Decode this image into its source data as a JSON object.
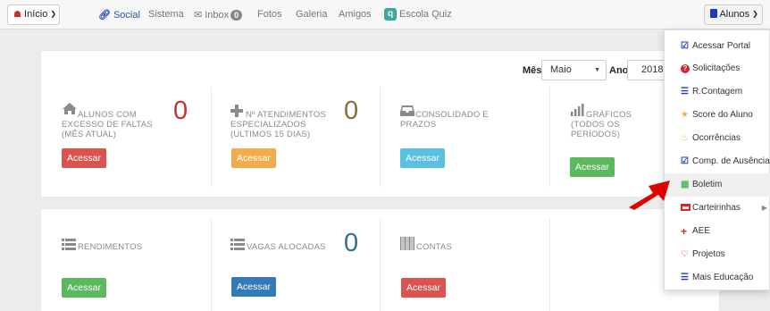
{
  "topbar": {
    "inicio_label": "Início",
    "nav": [
      {
        "label": "Social",
        "icon": "link-icon"
      },
      {
        "label": "Sistema",
        "icon": ""
      },
      {
        "label": "Inbox",
        "icon": "envelope-icon",
        "badge": "0"
      },
      {
        "label": "Fotos",
        "icon": ""
      },
      {
        "label": "Galeria",
        "icon": ""
      },
      {
        "label": "Amigos",
        "icon": ""
      },
      {
        "label": "Escola Quiz",
        "icon": "quiz-logo-icon"
      }
    ],
    "alunos_label": "Alunos"
  },
  "filters": {
    "mes_label": "Mês",
    "mes_value": "Maio",
    "ano_label": "Ano",
    "ano_value": "2018"
  },
  "cards_row1": [
    {
      "icon": "home-icon",
      "title_lines": [
        "ALUNOS COM",
        "EXCESSO DE FALTAS",
        "(MÊS ATUAL)"
      ],
      "count": "0",
      "count_color": "#c9302c",
      "button": "Acessar",
      "button_color": "red"
    },
    {
      "icon": "plus-icon",
      "title_lines": [
        "Nº ATENDIMENTOS",
        "ESPECIALIZADOS",
        "(ULTIMOS 15 DIAS)"
      ],
      "count": "0",
      "count_color": "#8a6d3b",
      "button": "Acessar",
      "button_color": "orange"
    },
    {
      "icon": "inbox-tray-icon",
      "title_lines": [
        "CONSOLIDADO E",
        "PRAZOS"
      ],
      "count": "",
      "button": "Acessar",
      "button_color": "cyan"
    },
    {
      "icon": "bar-chart-icon",
      "title_lines": [
        "GRÁFICOS",
        "(TODOS OS",
        "PERÍODOS)"
      ],
      "count": "",
      "button": "Acessar",
      "button_color": "green"
    }
  ],
  "cards_row2": [
    {
      "icon": "list-icon",
      "title_lines": [
        "RENDIMENTOS"
      ],
      "count": "",
      "button": "Acessar",
      "button_color": "green"
    },
    {
      "icon": "list-icon",
      "title_lines": [
        "VAGAS ALOCADAS"
      ],
      "count": "0",
      "count_color": "#31708f",
      "button": "Acessar",
      "button_color": "blue"
    },
    {
      "icon": "barcode-icon",
      "title_lines": [
        "CONTAS"
      ],
      "count": "",
      "button": "Acessar",
      "button_color": "red"
    }
  ],
  "menu": {
    "items": [
      {
        "label": "Acessar Portal",
        "icon": "check-square-icon",
        "icon_color": "#1a3dbf"
      },
      {
        "label": "Solicitações",
        "icon": "question-circle-icon",
        "icon_color": "#d9252b"
      },
      {
        "label": "R.Contagem",
        "icon": "list-icon",
        "icon_color": "#1a3dbf"
      },
      {
        "label": "Score do Aluno",
        "icon": "star-icon",
        "icon_color": "#f0ad4e"
      },
      {
        "label": "Ocorrências",
        "icon": "fire-icon",
        "icon_color": "#f0ad4e"
      },
      {
        "label": "Comp. de Ausência",
        "icon": "check-square-icon",
        "icon_color": "#1a3dbf"
      },
      {
        "label": "Boletim",
        "icon": "grid-icon",
        "icon_color": "#5cb85c",
        "active": true
      },
      {
        "label": "Carteirinhas",
        "icon": "card-icon",
        "icon_color": "#d9252b",
        "submenu": true
      },
      {
        "label": "AEE",
        "icon": "plus-icon",
        "icon_color": "#d9252b"
      },
      {
        "label": "Projetos",
        "icon": "heart-icon",
        "icon_color": "#d9252b"
      },
      {
        "label": "Mais Educação",
        "icon": "list-icon",
        "icon_color": "#1a3dbf"
      }
    ]
  },
  "annotation_arrow_color": "#e00000"
}
